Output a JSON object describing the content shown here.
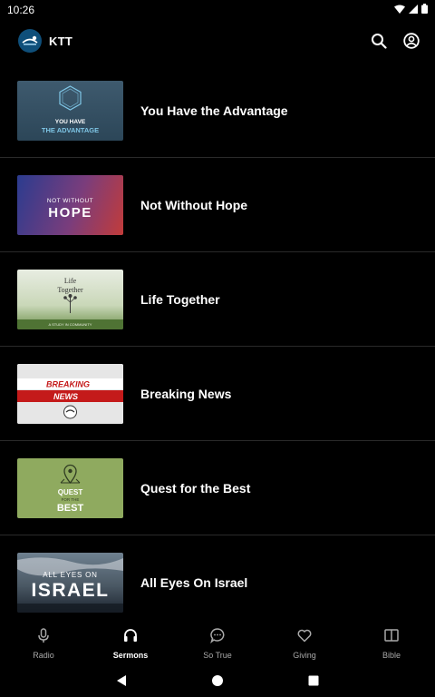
{
  "status_bar": {
    "time": "10:26",
    "icons": [
      "wifi-icon",
      "signal-icon",
      "battery-icon"
    ]
  },
  "app_bar": {
    "logo_text": "KTT",
    "title": "KTT",
    "actions": [
      "search-icon",
      "account-icon"
    ]
  },
  "sermons": [
    {
      "title": "You Have the Advantage",
      "thumb_text": [
        "YOU HAVE",
        "THE ADVANTAGE"
      ]
    },
    {
      "title": "Not Without Hope",
      "thumb_text": [
        "NOT WITHOUT",
        "HOPE"
      ]
    },
    {
      "title": "Life Together",
      "thumb_text": [
        "Life",
        "Together",
        "A STUDY IN COMMUNITY"
      ]
    },
    {
      "title": "Breaking News",
      "thumb_text": [
        "BREAKING",
        "NEWS"
      ]
    },
    {
      "title": "Quest for the Best",
      "thumb_text": [
        "QUEST",
        "FOR THE",
        "BEST"
      ]
    },
    {
      "title": "All Eyes On Israel",
      "thumb_text": [
        "ALL EYES ON",
        "ISRAEL"
      ]
    }
  ],
  "bottom_nav": {
    "items": [
      {
        "label": "Radio",
        "icon": "microphone-icon",
        "active": false
      },
      {
        "label": "Sermons",
        "icon": "headphones-icon",
        "active": true
      },
      {
        "label": "So True",
        "icon": "chat-bubble-icon",
        "active": false
      },
      {
        "label": "Giving",
        "icon": "heart-icon",
        "active": false
      },
      {
        "label": "Bible",
        "icon": "book-icon",
        "active": false
      }
    ]
  },
  "system_nav": [
    "back-icon",
    "home-icon",
    "recents-icon"
  ],
  "colors": {
    "background": "#000000",
    "divider": "#2a2a2a",
    "text_primary": "#ffffff",
    "text_secondary": "#a8a8a8",
    "logo_bg": "#0f4f7a"
  }
}
